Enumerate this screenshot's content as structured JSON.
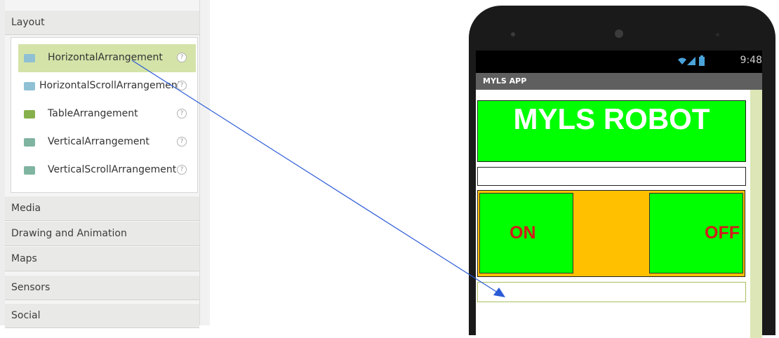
{
  "palette": {
    "categories_top": {
      "label": "Layout"
    },
    "layout_items": [
      {
        "label": "HorizontalArrangement",
        "icon": "horizontal-arrangement-icon",
        "selected": true
      },
      {
        "label": "HorizontalScrollArrangement",
        "icon": "horizontal-scroll-arrangement-icon",
        "selected": false
      },
      {
        "label": "TableArrangement",
        "icon": "table-arrangement-icon",
        "selected": false
      },
      {
        "label": "VerticalArrangement",
        "icon": "vertical-arrangement-icon",
        "selected": false
      },
      {
        "label": "VerticalScrollArrangement",
        "icon": "vertical-scroll-arrangement-icon",
        "selected": false
      }
    ],
    "help_glyph": "?",
    "categories_bottom": [
      {
        "label": "Media"
      },
      {
        "label": "Drawing and Animation"
      },
      {
        "label": "Maps"
      },
      {
        "label": "Sensors"
      },
      {
        "label": "Social"
      }
    ]
  },
  "phone": {
    "status_time": "9:48",
    "app_title": "MYLS APP",
    "screen_title": "MYLS ROBOT",
    "on_label": "ON",
    "off_label": "OFF"
  },
  "colors": {
    "selected_item_bg": "#d4e3a8",
    "title_bg": "#00ff00",
    "arrangement_bg": "#ffc000",
    "button_text": "#d21b1b",
    "arrow": "#2a5bd7"
  }
}
